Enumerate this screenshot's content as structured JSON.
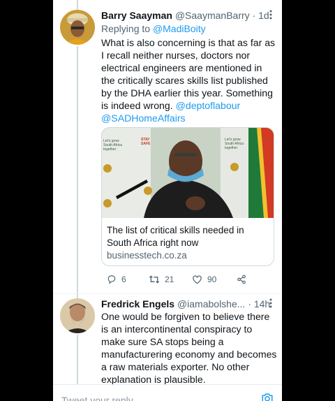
{
  "tweet1": {
    "name": "Barry Saayman",
    "handle": "@SaaymanBarry",
    "time": "· 1d",
    "replying_prefix": "Replying to ",
    "replying_to": "@MadiBoity",
    "text": "What is also concerning is that as far as I recall neither nurses, doctors nor electrical engineers are mentioned in the critically scares skills list published by the DHA earlier this year. Something is indeed wrong.",
    "mention1": "@deptoflabour",
    "mention2": "@SADHomeAffairs",
    "card": {
      "title": "The list of critical skills needed in South Africa right now",
      "domain": "businesstech.co.za",
      "backdrop_text_left": "Let's grow South Africa together",
      "backdrop_text_right": "Let's grow South Africa together",
      "backdrop_logo": "STAY SAFE"
    },
    "actions": {
      "replies": "6",
      "retweets": "21",
      "likes": "90"
    }
  },
  "tweet2": {
    "name": "Fredrick Engels",
    "handle": "@iamabolshe...",
    "time": "· 14h",
    "text": "One would be forgiven to believe there is an intercontinental conspiracy to make sure SA stops being a manufacturering economy and becomes a raw materials exporter. No other explanation is plausible."
  },
  "reply_bar": {
    "placeholder": "Tweet your reply"
  },
  "colors": {
    "link": "#1d9bf0",
    "muted": "#536471",
    "border": "#cfd9de"
  }
}
